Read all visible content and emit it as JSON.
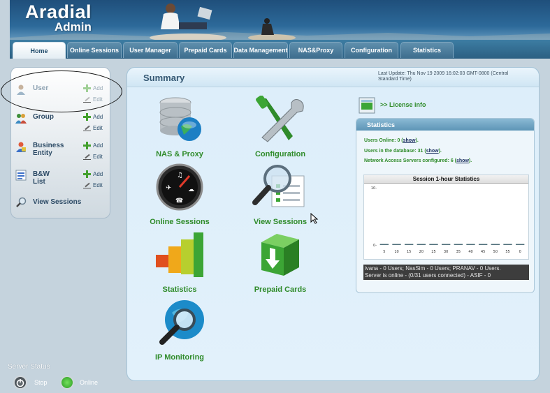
{
  "brand": {
    "line1": "Aradial",
    "line2": "Admin"
  },
  "tabs": [
    {
      "label": "Home",
      "active": true
    },
    {
      "label": "Online Sessions"
    },
    {
      "label": "User Manager"
    },
    {
      "label": "Prepaid Cards"
    },
    {
      "label": "Data Management"
    },
    {
      "label": "NAS&Proxy"
    },
    {
      "label": "Configuration"
    },
    {
      "label": "Statistics"
    }
  ],
  "sidebar": {
    "items": [
      {
        "label": "User",
        "add": "Add",
        "edit": "Edit",
        "icon": "user-icon",
        "dim": true
      },
      {
        "label": "Group",
        "add": "Add",
        "edit": "Edit",
        "icon": "group-icon"
      },
      {
        "label": "Business Entity",
        "add": "Add",
        "edit": "Edit",
        "icon": "business-entity-icon"
      },
      {
        "label": "B&W List",
        "add": "Add",
        "edit": "Edit",
        "icon": "list-icon"
      }
    ],
    "view_sessions": "View Sessions"
  },
  "summary": {
    "title": "Summary",
    "last_update": "Last Update: Thu Nov 19 2009 16:02:03 GMT-0800 (Central Standard Time)",
    "tiles": [
      {
        "label": "NAS & Proxy",
        "icon": "database-globe-icon"
      },
      {
        "label": "Configuration",
        "icon": "tools-icon"
      },
      {
        "label": "Online Sessions",
        "icon": "dashboard-icon"
      },
      {
        "label": "View Sessions",
        "icon": "magnifier-document-icon"
      },
      {
        "label": "Statistics",
        "icon": "bar-chart-icon"
      },
      {
        "label": "Prepaid Cards",
        "icon": "prepaid-box-icon"
      },
      {
        "label": "IP Monitoring",
        "icon": "globe-magnifier-icon"
      }
    ],
    "license_link": ">> License info"
  },
  "statistics": {
    "title": "Statistics",
    "users_online_prefix": "Users Online: 0 (",
    "users_db_prefix": "Users in the database: 31 (",
    "nas_prefix": "Network Access Servers configured: 6 (",
    "show": "show",
    "suffix": ").",
    "log_lines": [
      "ivana - 0 Users; NasSim - 0 Users; PRANAV - 0 Users.",
      "Server is online - (0/31 users connected) - ASIF - 0"
    ]
  },
  "chart_data": {
    "type": "bar",
    "title": "Session 1-hour Statistics",
    "categories": [
      "5",
      "10",
      "15",
      "20",
      "25",
      "30",
      "35",
      "40",
      "45",
      "50",
      "55",
      "0"
    ],
    "values": [
      0,
      0,
      0,
      0,
      0,
      0,
      0,
      0,
      0,
      0,
      0,
      0
    ],
    "ylim": [
      0,
      10
    ],
    "yticks": [
      "10",
      "0"
    ],
    "xlabel": "",
    "ylabel": "",
    "bar_color": "#4f6f7a"
  },
  "server_status": {
    "title": "Server Status",
    "stop": "Stop",
    "online": "Online"
  }
}
